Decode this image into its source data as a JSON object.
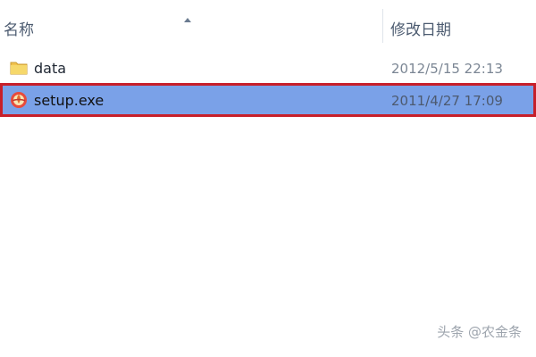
{
  "columns": {
    "name": "名称",
    "date_modified": "修改日期"
  },
  "files": [
    {
      "name": "data",
      "date_modified": "2012/5/15 22:13",
      "icon": "folder-icon"
    },
    {
      "name": "setup.exe",
      "date_modified": "2011/4/27 17:09",
      "icon": "setup-exe-icon"
    }
  ],
  "watermark": "头条 @农金条",
  "colors": {
    "selected_row_background": "#7aa1e8",
    "highlight_border": "#c71f2a"
  }
}
